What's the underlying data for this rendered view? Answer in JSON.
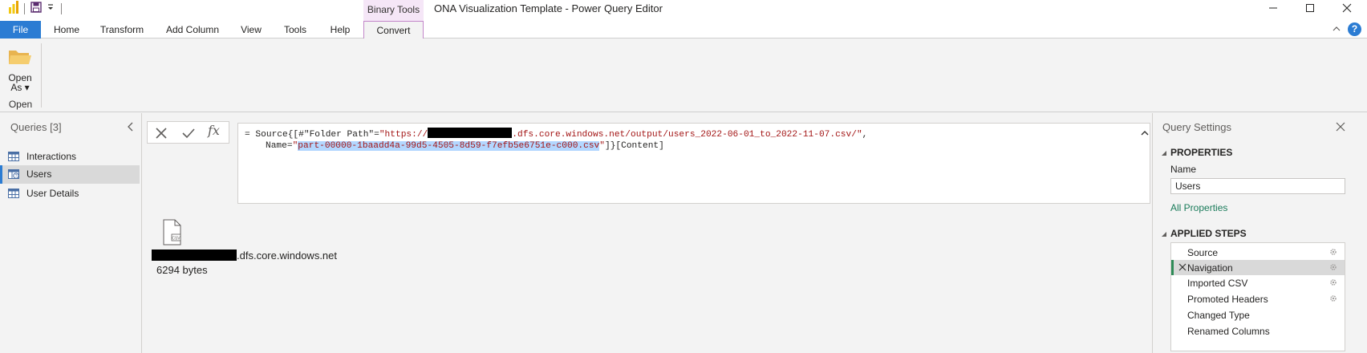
{
  "titlebar": {
    "context_group_label": "Binary Tools",
    "window_title": "ONA Visualization Template - Power Query Editor"
  },
  "ribbon": {
    "tabs": [
      "File",
      "Home",
      "Transform",
      "Add Column",
      "View",
      "Tools",
      "Help",
      "Convert"
    ],
    "active_tab": "Convert",
    "open_as": {
      "line1": "Open",
      "line2": "As ▾"
    },
    "group_label": "Open",
    "help_glyph": "?"
  },
  "queries": {
    "title": "Queries [3]",
    "items": [
      {
        "label": "Interactions",
        "icon": "table-icon"
      },
      {
        "label": "Users",
        "icon": "table-error-icon",
        "selected": true
      },
      {
        "label": "User Details",
        "icon": "table-icon"
      }
    ]
  },
  "formula": {
    "fx": "fx",
    "line1_prefix": "= Source{[#\"Folder Path\"=",
    "line1_str_start": "\"https://",
    "line1_str_end": ".dfs.core.windows.net/output/users_2022-06-01_to_2022-11-07.csv/\"",
    "line1_suffix": ",",
    "line2_prefix": "Name=",
    "line2_quote_open": "\"",
    "line2_highlight": "part-00000-1baadd4a-99d5-4505-8d59-f7efb5e6751e-c000.csv",
    "line2_quote_close": "\"",
    "line2_suffix": "]}[Content]"
  },
  "binary": {
    "file_icon_label": "CSV",
    "name_suffix": ".dfs.core.windows.net",
    "size": "6294 bytes"
  },
  "settings": {
    "title": "Query Settings",
    "properties_header": "PROPERTIES",
    "name_label": "Name",
    "name_value": "Users",
    "all_properties": "All Properties",
    "steps_header": "APPLIED STEPS",
    "steps": [
      {
        "label": "Source",
        "gear": true
      },
      {
        "label": "Navigation",
        "gear": true,
        "selected": true
      },
      {
        "label": "Imported CSV",
        "gear": true
      },
      {
        "label": "Promoted Headers",
        "gear": true
      },
      {
        "label": "Changed Type",
        "gear": false
      },
      {
        "label": "Renamed Columns",
        "gear": false
      }
    ]
  },
  "colors": {
    "file_tab": "#2b7cd3",
    "context_tab": "#f5e6f7",
    "string_literal": "#a31515",
    "selection": "#b3d7ff",
    "link": "#1a7b5a"
  }
}
